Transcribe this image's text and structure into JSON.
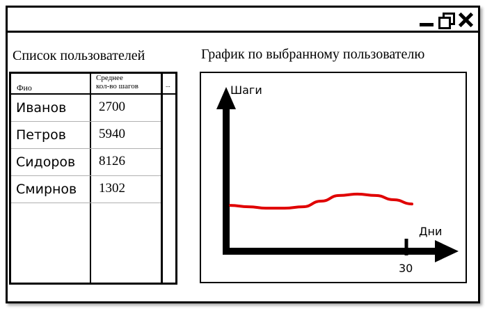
{
  "window": {
    "controls": {
      "minimize": "minimize-icon",
      "restore": "restore-icon",
      "close": "close-icon"
    }
  },
  "users_list": {
    "title": "Список пользователей",
    "columns": {
      "name": "Фио",
      "steps_line1": "Среднее",
      "steps_line2": "кол-во шагов",
      "more": "..."
    },
    "rows": [
      {
        "name": "Иванов",
        "steps": "2700"
      },
      {
        "name": "Петров",
        "steps": "5940"
      },
      {
        "name": "Сидоров",
        "steps": "8126"
      },
      {
        "name": "Смирнов",
        "steps": "1302"
      }
    ]
  },
  "chart": {
    "title": "График по выбранному пользователю",
    "line_color": "#e00000",
    "chart_data": {
      "type": "line",
      "ylabel": "Шаги",
      "xlabel": "Дни",
      "x_ticks": [
        "30"
      ],
      "grid": false,
      "series": [
        {
          "values": [
            0.3,
            0.29,
            0.28,
            0.28,
            0.29,
            0.33,
            0.37,
            0.38,
            0.37,
            0.34,
            0.31
          ]
        }
      ]
    }
  }
}
